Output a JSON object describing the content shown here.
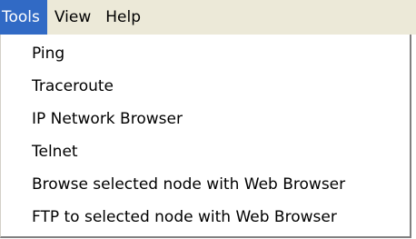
{
  "menubar": {
    "items": [
      {
        "label": "Tools",
        "active": true
      },
      {
        "label": "View",
        "active": false
      },
      {
        "label": "Help",
        "active": false
      }
    ]
  },
  "tools_menu": {
    "items": [
      {
        "label": "Ping"
      },
      {
        "label": "Traceroute"
      },
      {
        "label": "IP Network Browser"
      },
      {
        "label": "Telnet"
      },
      {
        "label": "Browse selected node with Web Browser"
      },
      {
        "label": "FTP to selected node with Web Browser"
      }
    ]
  },
  "colors": {
    "menubar_bg": "#ece9d8",
    "highlight_bg": "#316ac5",
    "highlight_text": "#ffffff",
    "menu_bg": "#ffffff",
    "menu_shadow": "#808080"
  }
}
